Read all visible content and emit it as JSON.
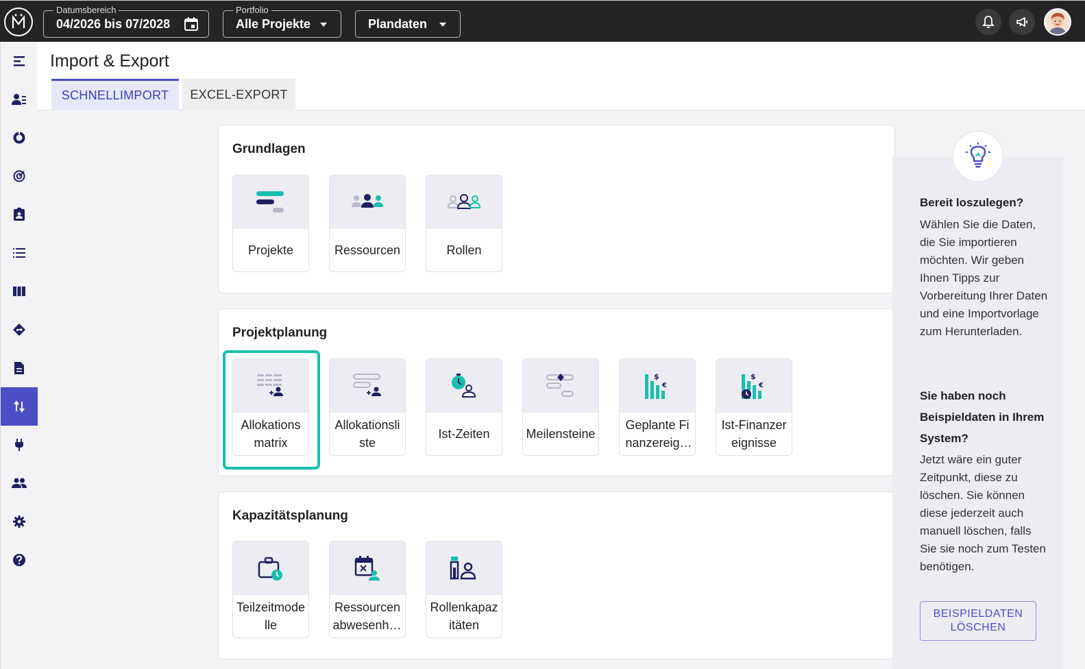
{
  "topbar": {
    "date_range": {
      "label": "Datumsbereich",
      "value": "04/2026 bis 07/2028"
    },
    "portfolio": {
      "label": "Portfolio",
      "value": "Alle Projekte"
    },
    "plan_select": {
      "value": "Plandaten"
    },
    "icons": [
      "app-logo",
      "calendar-icon",
      "bell-icon",
      "megaphone-icon",
      "avatar"
    ]
  },
  "sidebar": {
    "items": [
      {
        "icon": "menu-icon"
      },
      {
        "icon": "person-list-icon"
      },
      {
        "icon": "donut-chart-icon"
      },
      {
        "icon": "target-icon"
      },
      {
        "icon": "clipboard-person-icon"
      },
      {
        "icon": "list-icon"
      },
      {
        "icon": "columns-icon"
      },
      {
        "icon": "roadmap-diamond-icon"
      },
      {
        "icon": "document-icon"
      },
      {
        "icon": "import-export-icon",
        "active": true
      },
      {
        "icon": "plug-icon"
      },
      {
        "icon": "people-icon"
      },
      {
        "icon": "gear-icon"
      },
      {
        "icon": "help-icon"
      }
    ]
  },
  "header": {
    "title": "Import & Export",
    "tabs": [
      {
        "label": "SCHNELLIMPORT",
        "active": true
      },
      {
        "label": "EXCEL-EXPORT",
        "active": false
      }
    ]
  },
  "sections": [
    {
      "title": "Grundlagen",
      "tiles": [
        {
          "label": "Projekte",
          "icon": "projects-icon"
        },
        {
          "label": "Ressourcen",
          "icon": "resources-icon"
        },
        {
          "label": "Rollen",
          "icon": "roles-icon"
        }
      ]
    },
    {
      "title": "Projektplanung",
      "tiles": [
        {
          "label": "Allokationsmatrix",
          "icon": "allocation-matrix-icon",
          "selected": true
        },
        {
          "label": "Allokationsliste",
          "icon": "allocation-list-icon"
        },
        {
          "label": "Ist-Zeiten",
          "icon": "actual-times-icon"
        },
        {
          "label": "Meilensteine",
          "icon": "milestones-icon"
        },
        {
          "label": "Geplante Finanzereignisse",
          "icon": "planned-finance-icon"
        },
        {
          "label": "Ist-Finanzereignisse",
          "icon": "actual-finance-icon"
        }
      ]
    },
    {
      "title": "Kapazitätsplanung",
      "tiles": [
        {
          "label": "Teilzeitmodelle",
          "icon": "part-time-icon"
        },
        {
          "label": "Ressourcenabwesenheiten",
          "icon": "absence-icon"
        },
        {
          "label": "Rollenkapazitäten",
          "icon": "role-capacity-icon"
        }
      ]
    }
  ],
  "tips": {
    "icon": "lightbulb-icon",
    "heading1": "Bereit loszulegen?",
    "text1": "Wählen Sie die Daten, die Sie importieren möchten. Wir geben Ihnen Tipps zur Vorbereitung Ihrer Daten und eine Importvorlage zum Herunterladen.",
    "heading2": "Sie haben noch Beispieldaten in Ihrem System?",
    "text2": "Jetzt wäre ein guter Zeitpunkt, diese zu löschen. Sie können diese jederzeit auch manuell löschen, falls Sie sie noch zum Testen benötigen.",
    "button": "BEISPIELDATEN LÖSCHEN"
  },
  "colors": {
    "accent": "#4b4ec4",
    "teal": "#17bfae",
    "navy": "#1f2060",
    "topbar": "#242426"
  }
}
